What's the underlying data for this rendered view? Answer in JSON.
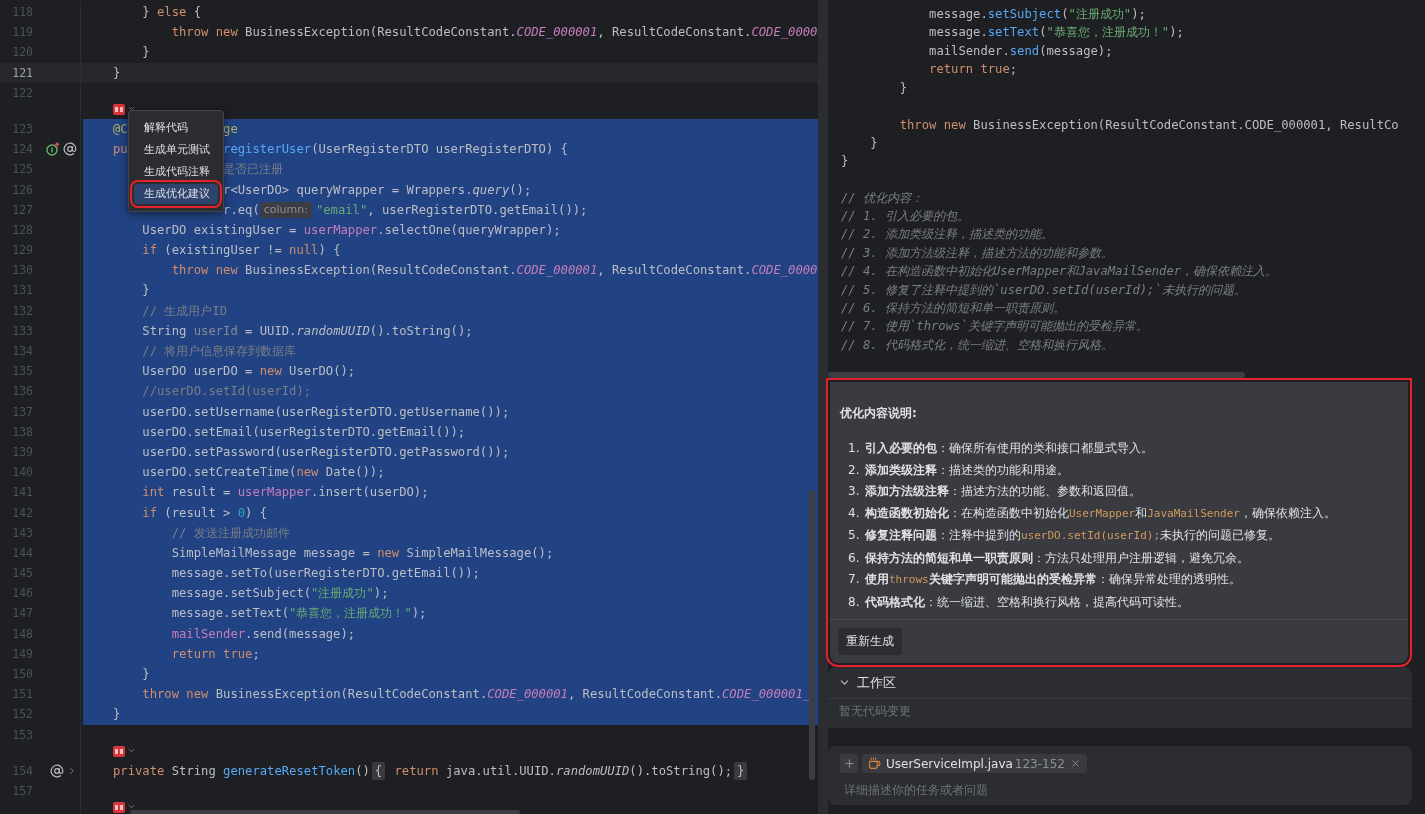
{
  "editor": {
    "lines": [
      {
        "kind": "code",
        "number": "118",
        "selected": false,
        "current": false,
        "tokens": [
          {
            "kind": "plain",
            "text": "    } "
          },
          {
            "kind": "keyword",
            "text": "else"
          },
          {
            "kind": "plain",
            "text": " {"
          }
        ]
      },
      {
        "kind": "code",
        "number": "119",
        "selected": false,
        "current": false,
        "tokens": [
          {
            "kind": "keyword",
            "text": "        throw new"
          },
          {
            "kind": "plain",
            "text": " BusinessException(ResultCodeConstant."
          },
          {
            "kind": "constant",
            "text": "CODE_000001"
          },
          {
            "kind": "plain",
            "text": ", ResultCodeConstant."
          },
          {
            "kind": "constant",
            "text": "CODE_0000"
          }
        ]
      },
      {
        "kind": "code",
        "number": "120",
        "selected": false,
        "current": false,
        "tokens": [
          {
            "kind": "plain",
            "text": "    }"
          }
        ]
      },
      {
        "kind": "code",
        "number": "121",
        "selected": false,
        "current": true,
        "tokens": [
          {
            "kind": "plain",
            "text": "}"
          }
        ]
      },
      {
        "kind": "code",
        "number": "122",
        "selected": false,
        "current": false
      },
      {
        "kind": "inlay"
      },
      {
        "kind": "code",
        "number": "123",
        "selected": true,
        "current": false,
        "tokens": [
          {
            "kind": "annotation",
            "text": "@C"
          },
          {
            "kind": "gap"
          },
          {
            "kind": "annotation",
            "text": "ge"
          }
        ]
      },
      {
        "kind": "code",
        "number": "124",
        "selected": true,
        "current": false,
        "gutter_icons": [
          {
            "kind": "implementation"
          },
          {
            "kind": "annotation"
          }
        ],
        "tokens": [
          {
            "kind": "keyword",
            "text": "pu"
          },
          {
            "kind": "gap"
          },
          {
            "kind": "method",
            "text": "registerUser"
          },
          {
            "kind": "plain",
            "text": "(UserRegisterDTO userRegisterDTO) {"
          }
        ]
      },
      {
        "kind": "code",
        "number": "125",
        "selected": true,
        "current": false,
        "tokens": [
          {
            "kind": "gap"
          },
          {
            "kind": "comment",
            "text": "是否已注册"
          }
        ]
      },
      {
        "kind": "code",
        "number": "126",
        "selected": true,
        "current": false,
        "tokens": [
          {
            "kind": "gap"
          },
          {
            "kind": "plain",
            "text": "r<UserDO> queryWrapper = Wrappers."
          },
          {
            "kind": "static",
            "text": "query"
          },
          {
            "kind": "plain",
            "text": "();"
          }
        ]
      },
      {
        "kind": "code",
        "number": "127",
        "selected": true,
        "current": false,
        "tokens": [
          {
            "kind": "gap"
          },
          {
            "kind": "plain",
            "text": "r.eq("
          },
          {
            "kind": "hint",
            "text": "column:"
          },
          {
            "kind": "string",
            "text": "\"email\""
          },
          {
            "kind": "plain",
            "text": ", userRegisterDTO.getEmail());"
          }
        ]
      },
      {
        "kind": "code",
        "number": "128",
        "selected": true,
        "current": false,
        "tokens": [
          {
            "kind": "plain",
            "text": "    UserDO existingUser = "
          },
          {
            "kind": "field",
            "text": "userMapper"
          },
          {
            "kind": "plain",
            "text": ".selectOne(queryWrapper);"
          }
        ]
      },
      {
        "kind": "code",
        "number": "129",
        "selected": true,
        "current": false,
        "tokens": [
          {
            "kind": "keyword",
            "text": "    if"
          },
          {
            "kind": "plain",
            "text": " (existingUser != "
          },
          {
            "kind": "keyword",
            "text": "null"
          },
          {
            "kind": "plain",
            "text": ") {"
          }
        ]
      },
      {
        "kind": "code",
        "number": "130",
        "selected": true,
        "current": false,
        "tokens": [
          {
            "kind": "keyword",
            "text": "        throw new"
          },
          {
            "kind": "plain",
            "text": " BusinessException(ResultCodeConstant."
          },
          {
            "kind": "constant",
            "text": "CODE_000001"
          },
          {
            "kind": "plain",
            "text": ", ResultCodeConstant."
          },
          {
            "kind": "constant",
            "text": "CODE_0000"
          }
        ]
      },
      {
        "kind": "code",
        "number": "131",
        "selected": true,
        "current": false,
        "tokens": [
          {
            "kind": "plain",
            "text": "    }"
          }
        ]
      },
      {
        "kind": "code",
        "number": "132",
        "selected": true,
        "current": false,
        "tokens": [
          {
            "kind": "comment",
            "text": "    // 生成用户ID"
          }
        ]
      },
      {
        "kind": "code",
        "number": "133",
        "selected": true,
        "current": false,
        "tokens": [
          {
            "kind": "plain",
            "text": "    String "
          },
          {
            "kind": "unused",
            "text": "userId"
          },
          {
            "kind": "plain",
            "text": " = UUID."
          },
          {
            "kind": "static",
            "text": "randomUUID"
          },
          {
            "kind": "plain",
            "text": "().toString();"
          }
        ]
      },
      {
        "kind": "code",
        "number": "134",
        "selected": true,
        "current": false,
        "tokens": [
          {
            "kind": "comment",
            "text": "    // 将用户信息保存到数据库"
          }
        ]
      },
      {
        "kind": "code",
        "number": "135",
        "selected": true,
        "current": false,
        "tokens": [
          {
            "kind": "plain",
            "text": "    UserDO userDO = "
          },
          {
            "kind": "keyword",
            "text": "new"
          },
          {
            "kind": "plain",
            "text": " UserDO();"
          }
        ]
      },
      {
        "kind": "code",
        "number": "136",
        "selected": true,
        "current": false,
        "tokens": [
          {
            "kind": "comment",
            "text": "    //userDO.setId(userId);"
          }
        ]
      },
      {
        "kind": "code",
        "number": "137",
        "selected": true,
        "current": false,
        "tokens": [
          {
            "kind": "plain",
            "text": "    userDO.setUsername(userRegisterDTO.getUsername());"
          }
        ]
      },
      {
        "kind": "code",
        "number": "138",
        "selected": true,
        "current": false,
        "tokens": [
          {
            "kind": "plain",
            "text": "    userDO.setEmail(userRegisterDTO.getEmail());"
          }
        ]
      },
      {
        "kind": "code",
        "number": "139",
        "selected": true,
        "current": false,
        "tokens": [
          {
            "kind": "plain",
            "text": "    userDO.setPassword(userRegisterDTO.getPassword());"
          }
        ]
      },
      {
        "kind": "code",
        "number": "140",
        "selected": true,
        "current": false,
        "tokens": [
          {
            "kind": "plain",
            "text": "    userDO.setCreateTime("
          },
          {
            "kind": "keyword",
            "text": "new"
          },
          {
            "kind": "plain",
            "text": " Date());"
          }
        ]
      },
      {
        "kind": "code",
        "number": "141",
        "selected": true,
        "current": false,
        "tokens": [
          {
            "kind": "keyword",
            "text": "    int"
          },
          {
            "kind": "plain",
            "text": " result = "
          },
          {
            "kind": "field",
            "text": "userMapper"
          },
          {
            "kind": "plain",
            "text": ".insert(userDO);"
          }
        ]
      },
      {
        "kind": "code",
        "number": "142",
        "selected": true,
        "current": false,
        "tokens": [
          {
            "kind": "keyword",
            "text": "    if"
          },
          {
            "kind": "plain",
            "text": " (result > "
          },
          {
            "kind": "number",
            "text": "0"
          },
          {
            "kind": "plain",
            "text": ") {"
          }
        ]
      },
      {
        "kind": "code",
        "number": "143",
        "selected": true,
        "current": false,
        "tokens": [
          {
            "kind": "comment",
            "text": "        // 发送注册成功邮件"
          }
        ]
      },
      {
        "kind": "code",
        "number": "144",
        "selected": true,
        "current": false,
        "tokens": [
          {
            "kind": "plain",
            "text": "        SimpleMailMessage message = "
          },
          {
            "kind": "keyword",
            "text": "new"
          },
          {
            "kind": "plain",
            "text": " SimpleMailMessage();"
          }
        ]
      },
      {
        "kind": "code",
        "number": "145",
        "selected": true,
        "current": false,
        "tokens": [
          {
            "kind": "plain",
            "text": "        message.setTo(userRegisterDTO.getEmail());"
          }
        ]
      },
      {
        "kind": "code",
        "number": "146",
        "selected": true,
        "current": false,
        "tokens": [
          {
            "kind": "plain",
            "text": "        message.setSubject("
          },
          {
            "kind": "string",
            "text": "\"注册成功\""
          },
          {
            "kind": "plain",
            "text": ");"
          }
        ]
      },
      {
        "kind": "code",
        "number": "147",
        "selected": true,
        "current": false,
        "tokens": [
          {
            "kind": "plain",
            "text": "        message.setText("
          },
          {
            "kind": "string",
            "text": "\"恭喜您，注册成功！\""
          },
          {
            "kind": "plain",
            "text": ");"
          }
        ]
      },
      {
        "kind": "code",
        "number": "148",
        "selected": true,
        "current": false,
        "tokens": [
          {
            "kind": "field",
            "text": "        mailSender"
          },
          {
            "kind": "plain",
            "text": ".send(message);"
          }
        ]
      },
      {
        "kind": "code",
        "number": "149",
        "selected": true,
        "current": false,
        "tokens": [
          {
            "kind": "keyword",
            "text": "        return true"
          },
          {
            "kind": "plain",
            "text": ";"
          }
        ]
      },
      {
        "kind": "code",
        "number": "150",
        "selected": true,
        "current": false,
        "tokens": [
          {
            "kind": "plain",
            "text": "    }"
          }
        ]
      },
      {
        "kind": "code",
        "number": "151",
        "selected": true,
        "current": false,
        "tokens": [
          {
            "kind": "keyword",
            "text": "    throw new"
          },
          {
            "kind": "plain",
            "text": " BusinessException(ResultCodeConstant."
          },
          {
            "kind": "constant",
            "text": "CODE_000001"
          },
          {
            "kind": "plain",
            "text": ", ResultCodeConstant."
          },
          {
            "kind": "constant",
            "text": "CODE_000001_"
          }
        ]
      },
      {
        "kind": "code",
        "number": "152",
        "selected": true,
        "current": false,
        "tokens": [
          {
            "kind": "plain",
            "text": "}"
          }
        ]
      },
      {
        "kind": "code",
        "number": "153",
        "selected": false,
        "current": false
      },
      {
        "kind": "inlay"
      },
      {
        "kind": "code",
        "number": "154",
        "selected": false,
        "current": false,
        "gutter_icons": [
          {
            "kind": "annotation"
          },
          {
            "kind": "expand"
          }
        ],
        "tokens": [
          {
            "kind": "keyword",
            "text": "private"
          },
          {
            "kind": "plain",
            "text": " String "
          },
          {
            "kind": "method",
            "text": "generateResetToken"
          },
          {
            "kind": "plain",
            "text": "()"
          },
          {
            "kind": "fold",
            "text": "{"
          },
          {
            "kind": "keyword",
            "text": " return"
          },
          {
            "kind": "plain",
            "text": " java.util.UUID."
          },
          {
            "kind": "static",
            "text": "randomUUID"
          },
          {
            "kind": "plain",
            "text": "().toString();"
          },
          {
            "kind": "fold",
            "text": "}"
          }
        ]
      },
      {
        "kind": "code",
        "number": "157",
        "selected": false,
        "current": false
      },
      {
        "kind": "inlay"
      }
    ],
    "context_menu": {
      "items": [
        {
          "label": "解释代码",
          "selected": false,
          "highlighted": false
        },
        {
          "label": "生成单元测试",
          "selected": false,
          "highlighted": false
        },
        {
          "label": "生成代码注释",
          "selected": false,
          "highlighted": false
        },
        {
          "label": "生成优化建议",
          "selected": true,
          "highlighted": true
        }
      ]
    }
  },
  "assistant": {
    "code_block": {
      "lines": [
        {
          "kind": "code",
          "tokens": [
            {
              "kind": "plain",
              "text": "            message."
            },
            {
              "kind": "method",
              "text": "setSubject"
            },
            {
              "kind": "plain",
              "text": "("
            },
            {
              "kind": "string",
              "text": "\"注册成功\""
            },
            {
              "kind": "plain",
              "text": ");"
            }
          ]
        },
        {
          "kind": "code",
          "tokens": [
            {
              "kind": "plain",
              "text": "            message."
            },
            {
              "kind": "method",
              "text": "setText"
            },
            {
              "kind": "plain",
              "text": "("
            },
            {
              "kind": "string",
              "text": "\"恭喜您，注册成功！\""
            },
            {
              "kind": "plain",
              "text": ");"
            }
          ]
        },
        {
          "kind": "code",
          "tokens": [
            {
              "kind": "plain",
              "text": "            mailSender."
            },
            {
              "kind": "method",
              "text": "send"
            },
            {
              "kind": "plain",
              "text": "(message);"
            }
          ]
        },
        {
          "kind": "code",
          "tokens": [
            {
              "kind": "keyword",
              "text": "            return true"
            },
            {
              "kind": "plain",
              "text": ";"
            }
          ]
        },
        {
          "kind": "code",
          "tokens": [
            {
              "kind": "plain",
              "text": "        }"
            }
          ]
        },
        {
          "kind": "blank"
        },
        {
          "kind": "code",
          "tokens": [
            {
              "kind": "keyword",
              "text": "        throw new"
            },
            {
              "kind": "plain",
              "text": " BusinessException(ResultCodeConstant.CODE_000001, ResultCo"
            }
          ]
        },
        {
          "kind": "code",
          "tokens": [
            {
              "kind": "plain",
              "text": "    }"
            }
          ]
        },
        {
          "kind": "code",
          "tokens": [
            {
              "kind": "plain",
              "text": "}"
            }
          ]
        },
        {
          "kind": "blank"
        },
        {
          "kind": "code",
          "tokens": [
            {
              "kind": "comment",
              "text": "// 优化内容："
            }
          ]
        },
        {
          "kind": "code",
          "tokens": [
            {
              "kind": "comment",
              "text": "// 1. 引入必要的包。"
            }
          ]
        },
        {
          "kind": "code",
          "tokens": [
            {
              "kind": "comment",
              "text": "// 2. 添加类级注释，描述类的功能。"
            }
          ]
        },
        {
          "kind": "code",
          "tokens": [
            {
              "kind": "comment",
              "text": "// 3. 添加方法级注释，描述方法的功能和参数。"
            }
          ]
        },
        {
          "kind": "code",
          "tokens": [
            {
              "kind": "comment",
              "text": "// 4. 在构造函数中初始化UserMapper和JavaMailSender，确保依赖注入。"
            }
          ]
        },
        {
          "kind": "code",
          "tokens": [
            {
              "kind": "comment",
              "text": "// 5. 修复了注释中提到的`userDO.setId(userId);`未执行的问题。"
            }
          ]
        },
        {
          "kind": "code",
          "tokens": [
            {
              "kind": "comment",
              "text": "// 6. 保持方法的简短和单一职责原则。"
            }
          ]
        },
        {
          "kind": "code",
          "tokens": [
            {
              "kind": "comment",
              "text": "// 7. 使用`throws`关键字声明可能抛出的受检异常。"
            }
          ]
        },
        {
          "kind": "code",
          "tokens": [
            {
              "kind": "comment",
              "text": "// 8. 代码格式化，统一缩进、空格和换行风格。"
            }
          ]
        }
      ]
    },
    "explanation": {
      "highlighted": true,
      "title": "优化内容说明:",
      "items": [
        {
          "number": "1.",
          "segments": [
            {
              "kind": "bold",
              "text": "引入必要的包"
            },
            {
              "kind": "text",
              "text": "：确保所有使用的类和接口都显式导入。"
            }
          ]
        },
        {
          "number": "2.",
          "segments": [
            {
              "kind": "bold",
              "text": "添加类级注释"
            },
            {
              "kind": "text",
              "text": "：描述类的功能和用途。"
            }
          ]
        },
        {
          "number": "3.",
          "segments": [
            {
              "kind": "bold",
              "text": "添加方法级注释"
            },
            {
              "kind": "text",
              "text": "：描述方法的功能、参数和返回值。"
            }
          ]
        },
        {
          "number": "4.",
          "segments": [
            {
              "kind": "bold",
              "text": "构造函数初始化"
            },
            {
              "kind": "text",
              "text": "：在构造函数中初始化"
            },
            {
              "kind": "code",
              "text": "UserMapper"
            },
            {
              "kind": "text",
              "text": "和"
            },
            {
              "kind": "code",
              "text": "JavaMailSender"
            },
            {
              "kind": "text",
              "text": "，确保依赖注入。"
            }
          ]
        },
        {
          "number": "5.",
          "segments": [
            {
              "kind": "bold",
              "text": "修复注释问题"
            },
            {
              "kind": "text",
              "text": "：注释中提到的"
            },
            {
              "kind": "code",
              "text": "userDO.setId(userId);"
            },
            {
              "kind": "text",
              "text": "未执行的问题已修复。"
            }
          ]
        },
        {
          "number": "6.",
          "segments": [
            {
              "kind": "bold",
              "text": "保持方法的简短和单一职责原则"
            },
            {
              "kind": "text",
              "text": "：方法只处理用户注册逻辑，避免冗余。"
            }
          ]
        },
        {
          "number": "7.",
          "segments": [
            {
              "kind": "bold",
              "text": "使用"
            },
            {
              "kind": "code",
              "text": "throws"
            },
            {
              "kind": "bold",
              "text": "关键字声明可能抛出的受检异常"
            },
            {
              "kind": "text",
              "text": "：确保异常处理的透明性。"
            }
          ]
        },
        {
          "number": "8.",
          "segments": [
            {
              "kind": "bold",
              "text": "代码格式化"
            },
            {
              "kind": "text",
              "text": "：统一缩进、空格和换行风格，提高代码可读性。"
            }
          ]
        }
      ],
      "button": "重新生成"
    },
    "workspace": {
      "title": "工作区",
      "expanded": true,
      "empty_text": "暂无代码变更"
    },
    "input": {
      "file_chip": {
        "name": "UserServiceImpl.java",
        "range": "123-152"
      },
      "placeholder": "详细描述你的任务或者问题"
    }
  }
}
